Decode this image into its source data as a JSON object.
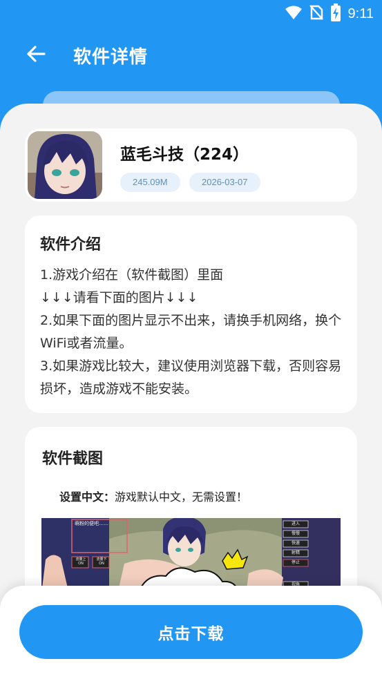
{
  "status_bar": {
    "time": "9:11",
    "icons": [
      "wifi-icon",
      "no-sim-icon",
      "battery-charging-icon"
    ]
  },
  "header": {
    "title": "软件详情",
    "back_icon": "arrow-left-icon"
  },
  "app": {
    "name": "蓝毛斗技（224）",
    "size": "245.09M",
    "date": "2026-03-07"
  },
  "intro": {
    "title": "软件介绍",
    "lines": [
      "1.游戏介绍在（软件截图）里面",
      "↓↓↓请看下面的图片↓↓↓",
      "2.如果下面的图片显示不出来，请换手机网络，换个WiFi或者流量。",
      "3.如果游戏比较大，建议使用浏览器下载，否则容易损坏，造成游戏不能安装。"
    ]
  },
  "screenshots": {
    "title": "软件截图",
    "note_label": "设置中文：",
    "note_text": "游戏默认中文，无需设置！",
    "game_ui": {
      "dialog": "萌粉的便吧……",
      "button_a": "流量上\nON",
      "button_b": "流量下\nON",
      "menu": [
        "进入",
        "慢慢",
        "快速",
        "射精",
        "停止"
      ],
      "menu_bottom": "视角"
    }
  },
  "download": {
    "label": "点击下载"
  },
  "colors": {
    "primary": "#2196F3",
    "chip_bg": "#e6f1fb",
    "chip_text": "#5d8fbf",
    "sheet_bg": "#f3f3f3"
  }
}
